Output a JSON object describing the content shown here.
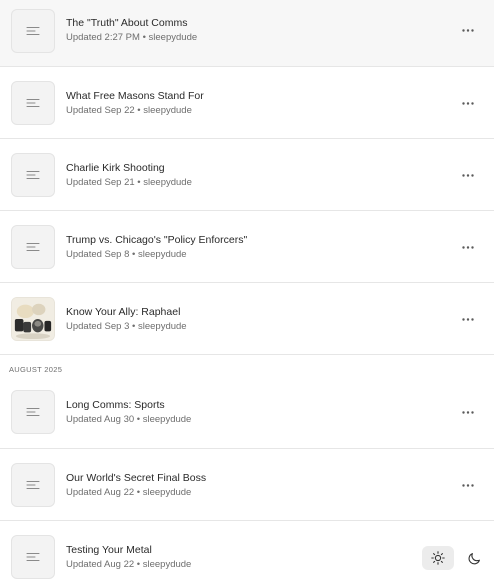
{
  "sections": [
    {
      "header": "",
      "posts": [
        {
          "title": "The \"Truth\" About Comms",
          "meta": "Updated 2:27 PM • sleepydude",
          "thumb": "doc-icon",
          "more": "more-horizontal-icon"
        },
        {
          "title": "What Free Masons Stand For",
          "meta": "Updated Sep 22 • sleepydude",
          "thumb": "doc-icon",
          "more": "more-horizontal-icon"
        },
        {
          "title": "Charlie Kirk Shooting",
          "meta": "Updated Sep 21 • sleepydude",
          "thumb": "doc-icon",
          "more": "more-horizontal-icon"
        },
        {
          "title": "Trump vs. Chicago's \"Policy Enforcers\"",
          "meta": "Updated Sep 8 • sleepydude",
          "thumb": "doc-icon",
          "more": "more-horizontal-icon"
        },
        {
          "title": "Know Your Ally: Raphael",
          "meta": "Updated Sep 3 • sleepydude",
          "thumb": "photo",
          "more": "more-horizontal-icon"
        }
      ]
    },
    {
      "header": "AUGUST 2025",
      "posts": [
        {
          "title": "Long Comms: Sports",
          "meta": "Updated Aug 30 • sleepydude",
          "thumb": "doc-icon",
          "more": "more-horizontal-icon"
        },
        {
          "title": "Our World's Secret Final Boss",
          "meta": "Updated Aug 22 • sleepydude",
          "thumb": "doc-icon",
          "more": "more-horizontal-icon"
        },
        {
          "title": "Testing Your Metal",
          "meta": "Updated Aug 22 • sleepydude",
          "thumb": "doc-icon",
          "more": null
        }
      ]
    }
  ],
  "theme_toggle": {
    "light_icon": "sun-icon",
    "dark_icon": "moon-icon",
    "active": "light"
  },
  "colors": {
    "row_highlight": "#f7f7f7",
    "divider": "#e6e6e6",
    "meta_text": "#6e6e6e",
    "title_text": "#2a2a2a"
  }
}
